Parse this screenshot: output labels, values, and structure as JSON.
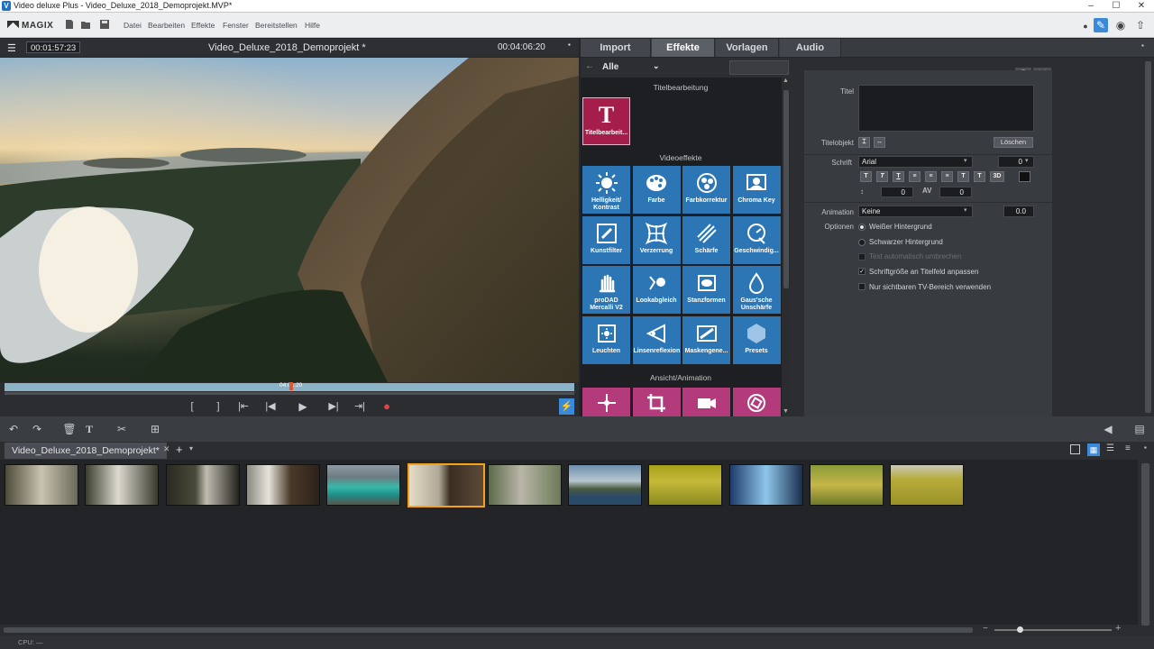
{
  "window": {
    "title": "Video deluxe Plus - Video_Deluxe_2018_Demoprojekt.MVP*",
    "app_icon": "V"
  },
  "menubar": {
    "logo": "MAGIX",
    "items": [
      "Datei",
      "Bearbeiten",
      "Effekte",
      "Fenster",
      "Bereitstellen",
      "Hilfe"
    ]
  },
  "preview": {
    "timecode_current": "00:01:57:23",
    "project_title": "Video_Deluxe_2018_Demoprojekt *",
    "timecode_total": "00:04:06:20",
    "scrub_marker": "04:0...20",
    "playback_progress": 0.5
  },
  "right_tabs": [
    "Import",
    "Effekte",
    "Vorlagen",
    "Audio"
  ],
  "active_tab": "Effekte",
  "effects": {
    "filter_label": "Alle",
    "section_title": "Titelbearbeitung",
    "title_tile": {
      "glyph": "T",
      "label": "Titelbearbeit..."
    },
    "section_video": "Videoeffekte",
    "tiles": [
      {
        "label": "Helligkeit/ Kontrast",
        "icon": "sun-icon"
      },
      {
        "label": "Farbe",
        "icon": "palette-icon"
      },
      {
        "label": "Farbkorrektur",
        "icon": "color-wheel-icon"
      },
      {
        "label": "Chroma Key",
        "icon": "chroma-key-icon"
      },
      {
        "label": "Kunstfilter",
        "icon": "art-filter-icon"
      },
      {
        "label": "Verzerrung",
        "icon": "distortion-icon"
      },
      {
        "label": "Schärfe",
        "icon": "sharpen-icon"
      },
      {
        "label": "Geschwindig...",
        "icon": "speed-icon"
      },
      {
        "label": "proDAD Mercalli V2",
        "icon": "hand-icon"
      },
      {
        "label": "Lookabgleich",
        "icon": "look-match-icon"
      },
      {
        "label": "Stanzformen",
        "icon": "shapes-icon"
      },
      {
        "label": "Gaus'sche Unschärfe",
        "icon": "blur-drop-icon"
      },
      {
        "label": "Leuchten",
        "icon": "glow-icon"
      },
      {
        "label": "Linsenreflexion",
        "icon": "lens-flare-icon"
      },
      {
        "label": "Maskengene...",
        "icon": "mask-icon"
      },
      {
        "label": "Presets",
        "icon": "hexagon-icon"
      }
    ],
    "section_animation": "Ansicht/Animation",
    "anim_tiles": [
      "move-icon",
      "crop-icon",
      "camera-icon",
      "rotate-icon"
    ]
  },
  "properties": {
    "title_label": "Titel",
    "title_object_label": "Titelobjekt",
    "delete_button": "Löschen",
    "font_label": "Schrift",
    "font_value": "Arial",
    "font_size": "0",
    "line_spacing": "0",
    "char_spacing": "0",
    "animation_label": "Animation",
    "animation_value": "Keine",
    "animation_amount": "0.0",
    "options_label": "Optionen",
    "radio_options": [
      "Weißer Hintergrund",
      "Schwarzer Hintergrund"
    ],
    "radio_selected": 0,
    "checkboxes": [
      {
        "label": "Text automatisch umbrechen",
        "checked": false,
        "disabled": true
      },
      {
        "label": "Schriftgröße an Titelfeld anpassen",
        "checked": true,
        "disabled": false
      },
      {
        "label": "Nur sichtbaren TV-Bereich verwenden",
        "checked": false,
        "disabled": false
      }
    ]
  },
  "timeline": {
    "project_tab": "Video_Deluxe_2018_Demoprojekt*",
    "clip_count": 12,
    "selected_clip": 5
  },
  "status": {
    "cpu": "CPU: —"
  }
}
